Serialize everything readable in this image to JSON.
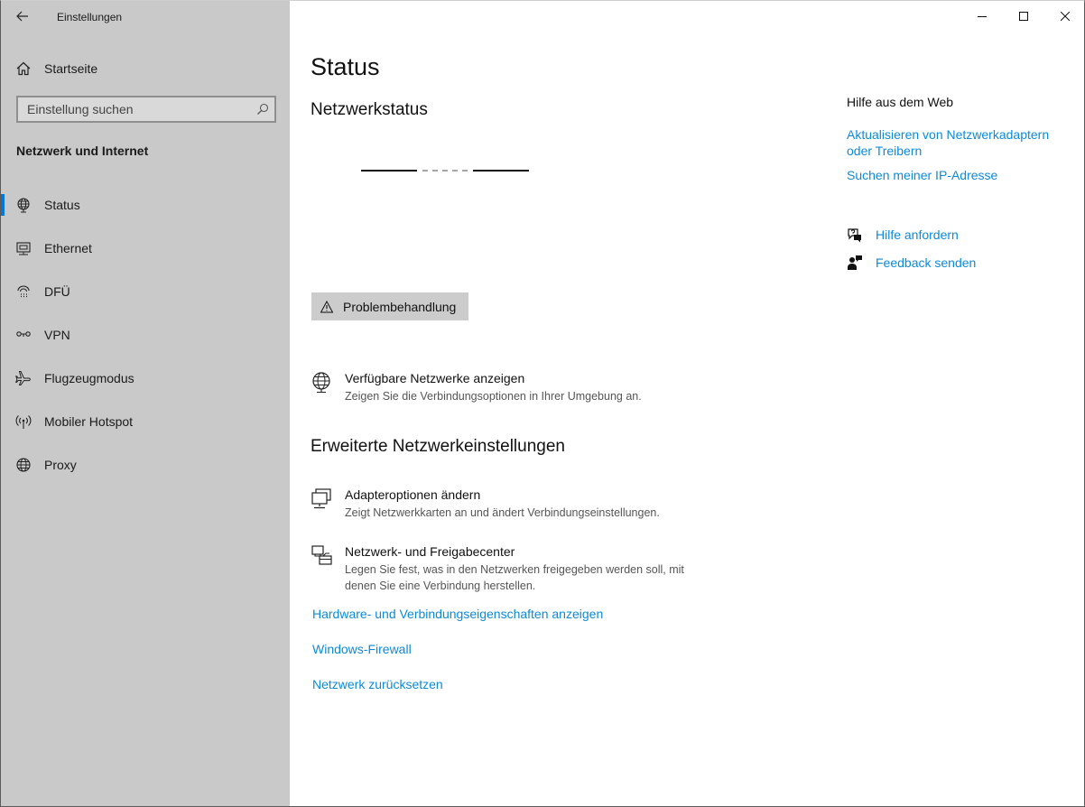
{
  "window": {
    "app_title": "Einstellungen",
    "back_icon": "back-arrow-icon",
    "controls": [
      "minimize-icon",
      "maximize-icon",
      "close-icon"
    ]
  },
  "sidebar": {
    "home_label": "Startseite",
    "search_placeholder": "Einstellung suchen",
    "section_title": "Netzwerk und Internet",
    "items": [
      {
        "label": "Status",
        "icon": "globe-icon",
        "active": true
      },
      {
        "label": "Ethernet",
        "icon": "ethernet-icon",
        "active": false
      },
      {
        "label": "DFÜ",
        "icon": "dialup-icon",
        "active": false
      },
      {
        "label": "VPN",
        "icon": "vpn-icon",
        "active": false
      },
      {
        "label": "Flugzeugmodus",
        "icon": "airplane-icon",
        "active": false
      },
      {
        "label": "Mobiler Hotspot",
        "icon": "hotspot-icon",
        "active": false
      },
      {
        "label": "Proxy",
        "icon": "proxy-globe-icon",
        "active": false
      }
    ]
  },
  "main": {
    "title": "Status",
    "network_status_heading": "Netzwerkstatus",
    "troubleshoot_label": "Problembehandlung",
    "available_networks": {
      "title": "Verfügbare Netzwerke anzeigen",
      "description": "Zeigen Sie die Verbindungsoptionen in Ihrer Umgebung an."
    },
    "advanced_heading": "Erweiterte Netzwerkeinstellungen",
    "adapter_options": {
      "title": "Adapteroptionen ändern",
      "description": "Zeigt Netzwerkkarten an und ändert Verbindungseinstellungen."
    },
    "sharing_center": {
      "title": "Netzwerk- und Freigabecenter",
      "description": "Legen Sie fest, was in den Netzwerken freigegeben werden soll, mit denen Sie eine Verbindung herstellen."
    },
    "links": [
      "Hardware- und Verbindungseigenschaften anzeigen",
      "Windows-Firewall",
      "Netzwerk zurücksetzen"
    ]
  },
  "help_panel": {
    "title": "Hilfe aus dem Web",
    "links": [
      "Aktualisieren von Netzwerkadaptern oder Treibern",
      "Suchen meiner IP-Adresse"
    ],
    "actions": [
      {
        "label": "Hilfe anfordern",
        "icon": "chat-help-icon"
      },
      {
        "label": "Feedback senden",
        "icon": "feedback-icon"
      }
    ]
  },
  "colors": {
    "sidebar_bg": "#c9c9c9",
    "accent": "#0078d7",
    "link": "#0b8adb"
  }
}
